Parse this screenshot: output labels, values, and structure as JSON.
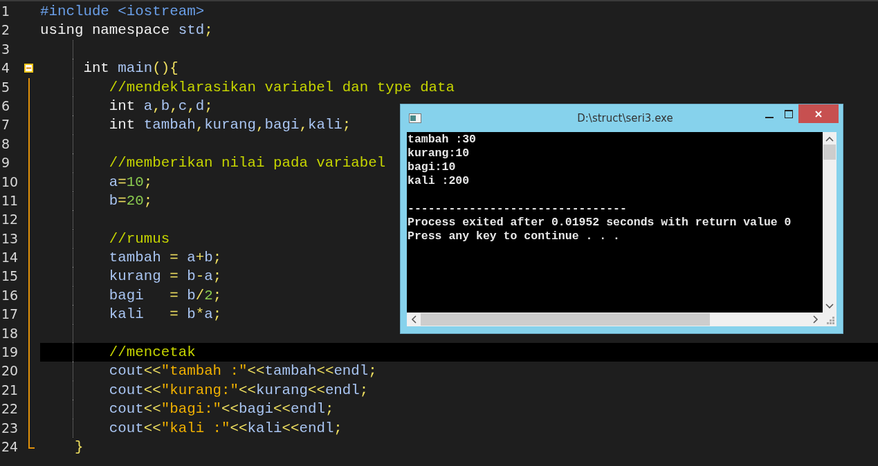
{
  "editor": {
    "lines": [
      {
        "number": "1",
        "current": false,
        "kind": "plain",
        "tokens": [
          {
            "kind": "pre",
            "text": "#include <iostream>"
          }
        ]
      },
      {
        "number": "2",
        "current": false,
        "kind": "plain",
        "tokens": [
          {
            "kind": "kw",
            "text": "using namespace "
          },
          {
            "kind": "id",
            "text": "std"
          },
          {
            "kind": "op",
            "text": ";"
          }
        ]
      },
      {
        "number": "3",
        "current": false,
        "kind": "plain"
      },
      {
        "number": "4",
        "current": false,
        "kind": "fold_start",
        "expanded": true,
        "tokens": [
          {
            "kind": "kw",
            "text": "     int "
          },
          {
            "kind": "id",
            "text": "main"
          },
          {
            "kind": "op",
            "text": "(){"
          }
        ]
      },
      {
        "number": "5",
        "current": false,
        "kind": "fold_body",
        "tokens": [
          {
            "kind": "comment",
            "text": "        //mendeklarasikan variabel dan type data"
          }
        ]
      },
      {
        "number": "6",
        "current": false,
        "kind": "fold_body",
        "tokens": [
          {
            "kind": "kw",
            "text": "        int "
          },
          {
            "kind": "id",
            "text": "a"
          },
          {
            "kind": "op",
            "text": ","
          },
          {
            "kind": "id",
            "text": "b"
          },
          {
            "kind": "op",
            "text": ","
          },
          {
            "kind": "id",
            "text": "c"
          },
          {
            "kind": "op",
            "text": ","
          },
          {
            "kind": "id",
            "text": "d"
          },
          {
            "kind": "op",
            "text": ";"
          }
        ]
      },
      {
        "number": "7",
        "current": false,
        "kind": "fold_body",
        "tokens": [
          {
            "kind": "kw",
            "text": "        int "
          },
          {
            "kind": "id",
            "text": "tambah"
          },
          {
            "kind": "op",
            "text": ","
          },
          {
            "kind": "id",
            "text": "kurang"
          },
          {
            "kind": "op",
            "text": ","
          },
          {
            "kind": "id",
            "text": "bagi"
          },
          {
            "kind": "op",
            "text": ","
          },
          {
            "kind": "id",
            "text": "kali"
          },
          {
            "kind": "op",
            "text": ";"
          }
        ]
      },
      {
        "number": "8",
        "current": false,
        "kind": "fold_body"
      },
      {
        "number": "9",
        "current": false,
        "kind": "fold_body",
        "tokens": [
          {
            "kind": "comment",
            "text": "        //memberikan nilai pada variabel"
          }
        ]
      },
      {
        "number": "10",
        "current": false,
        "kind": "fold_body",
        "tokens": [
          {
            "kind": "id",
            "text": "        a"
          },
          {
            "kind": "op",
            "text": "="
          },
          {
            "kind": "num",
            "text": "10"
          },
          {
            "kind": "op",
            "text": ";"
          }
        ]
      },
      {
        "number": "11",
        "current": false,
        "kind": "fold_body",
        "tokens": [
          {
            "kind": "id",
            "text": "        b"
          },
          {
            "kind": "op",
            "text": "="
          },
          {
            "kind": "num",
            "text": "20"
          },
          {
            "kind": "op",
            "text": ";"
          }
        ]
      },
      {
        "number": "12",
        "current": false,
        "kind": "fold_body"
      },
      {
        "number": "13",
        "current": false,
        "kind": "fold_body",
        "tokens": [
          {
            "kind": "comment",
            "text": "        //rumus"
          }
        ]
      },
      {
        "number": "14",
        "current": false,
        "kind": "fold_body",
        "tokens": [
          {
            "kind": "id",
            "text": "        tambah "
          },
          {
            "kind": "op",
            "text": "="
          },
          {
            "kind": "id",
            "text": " a"
          },
          {
            "kind": "op",
            "text": "+"
          },
          {
            "kind": "id",
            "text": "b"
          },
          {
            "kind": "op",
            "text": ";"
          }
        ]
      },
      {
        "number": "15",
        "current": false,
        "kind": "fold_body",
        "tokens": [
          {
            "kind": "id",
            "text": "        kurang "
          },
          {
            "kind": "op",
            "text": "="
          },
          {
            "kind": "id",
            "text": " b"
          },
          {
            "kind": "op",
            "text": "-"
          },
          {
            "kind": "id",
            "text": "a"
          },
          {
            "kind": "op",
            "text": ";"
          }
        ]
      },
      {
        "number": "16",
        "current": false,
        "kind": "fold_body",
        "tokens": [
          {
            "kind": "id",
            "text": "        bagi   "
          },
          {
            "kind": "op",
            "text": "="
          },
          {
            "kind": "id",
            "text": " b"
          },
          {
            "kind": "op",
            "text": "/"
          },
          {
            "kind": "num",
            "text": "2"
          },
          {
            "kind": "op",
            "text": ";"
          }
        ]
      },
      {
        "number": "17",
        "current": false,
        "kind": "fold_body",
        "tokens": [
          {
            "kind": "id",
            "text": "        kali   "
          },
          {
            "kind": "op",
            "text": "="
          },
          {
            "kind": "id",
            "text": " b"
          },
          {
            "kind": "op",
            "text": "*"
          },
          {
            "kind": "id",
            "text": "a"
          },
          {
            "kind": "op",
            "text": ";"
          }
        ]
      },
      {
        "number": "18",
        "current": false,
        "kind": "fold_body"
      },
      {
        "number": "19",
        "current": true,
        "kind": "fold_body",
        "tokens": [
          {
            "kind": "comment",
            "text": "        //mencetak"
          }
        ]
      },
      {
        "number": "20",
        "current": false,
        "kind": "fold_body",
        "tokens": [
          {
            "kind": "id",
            "text": "        cout"
          },
          {
            "kind": "op",
            "text": "<<"
          },
          {
            "kind": "str",
            "text": "\"tambah :\""
          },
          {
            "kind": "op",
            "text": "<<"
          },
          {
            "kind": "id",
            "text": "tambah"
          },
          {
            "kind": "op",
            "text": "<<"
          },
          {
            "kind": "id",
            "text": "endl"
          },
          {
            "kind": "op",
            "text": ";"
          }
        ]
      },
      {
        "number": "21",
        "current": false,
        "kind": "fold_body",
        "tokens": [
          {
            "kind": "id",
            "text": "        cout"
          },
          {
            "kind": "op",
            "text": "<<"
          },
          {
            "kind": "str",
            "text": "\"kurang:\""
          },
          {
            "kind": "op",
            "text": "<<"
          },
          {
            "kind": "id",
            "text": "kurang"
          },
          {
            "kind": "op",
            "text": "<<"
          },
          {
            "kind": "id",
            "text": "endl"
          },
          {
            "kind": "op",
            "text": ";"
          }
        ]
      },
      {
        "number": "22",
        "current": false,
        "kind": "fold_body",
        "tokens": [
          {
            "kind": "id",
            "text": "        cout"
          },
          {
            "kind": "op",
            "text": "<<"
          },
          {
            "kind": "str",
            "text": "\"bagi:\""
          },
          {
            "kind": "op",
            "text": "<<"
          },
          {
            "kind": "id",
            "text": "bagi"
          },
          {
            "kind": "op",
            "text": "<<"
          },
          {
            "kind": "id",
            "text": "endl"
          },
          {
            "kind": "op",
            "text": ";"
          }
        ]
      },
      {
        "number": "23",
        "current": false,
        "kind": "fold_body",
        "tokens": [
          {
            "kind": "id",
            "text": "        cout"
          },
          {
            "kind": "op",
            "text": "<<"
          },
          {
            "kind": "str",
            "text": "\"kali :\""
          },
          {
            "kind": "op",
            "text": "<<"
          },
          {
            "kind": "id",
            "text": "kali"
          },
          {
            "kind": "op",
            "text": "<<"
          },
          {
            "kind": "id",
            "text": "endl"
          },
          {
            "kind": "op",
            "text": ";"
          }
        ]
      },
      {
        "number": "24",
        "current": false,
        "kind": "fold_end",
        "tokens": [
          {
            "kind": "op",
            "text": "    }"
          }
        ]
      }
    ]
  },
  "console": {
    "window": {
      "title": "D:\\struct\\seri3.exe"
    },
    "blocks": [
      [
        "tambah :30",
        "kurang:10",
        "bagi:10",
        "kali :200"
      ],
      [
        "--------------------------------",
        "Process exited after 0.01952 seconds with return value 0",
        "Press any key to continue . . ."
      ]
    ]
  }
}
